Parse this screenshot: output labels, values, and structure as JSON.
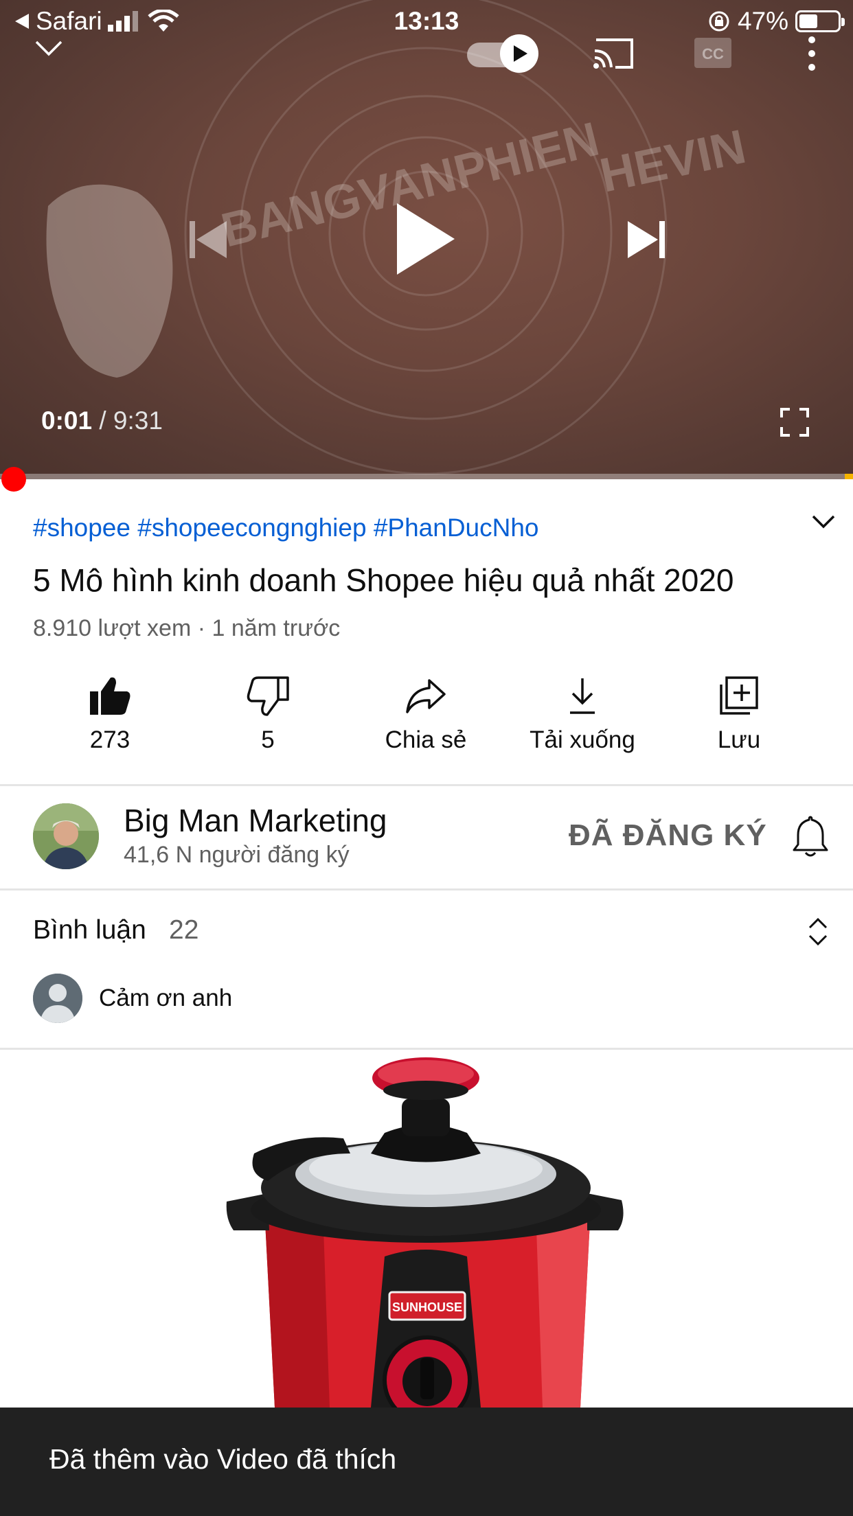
{
  "status_bar": {
    "back_app": "Safari",
    "time": "13:13",
    "battery": "47%"
  },
  "player": {
    "current_time": "0:01",
    "duration": "/ 9:31",
    "progress": 0.002,
    "autoplay_on": true,
    "icons": [
      "chevron-down-icon",
      "autoplay-toggle",
      "cast-icon",
      "cc-icon",
      "more-icon",
      "previous-icon",
      "play-icon",
      "next-icon",
      "fullscreen-icon"
    ]
  },
  "video": {
    "hashtags": "#shopee #shopeecongnghiep #PhanDucNho",
    "title": "5 Mô hình kinh doanh Shopee hiệu quả nhất 2020",
    "meta": "8.910 lượt xem · 1 năm trước"
  },
  "actions": [
    {
      "label": "273",
      "icon": "thumbs-up-filled-icon"
    },
    {
      "label": "5",
      "icon": "thumbs-down-icon"
    },
    {
      "label": "Chia sẻ",
      "icon": "share-icon"
    },
    {
      "label": "Tải xuống",
      "icon": "download-icon"
    },
    {
      "label": "Lưu",
      "icon": "save-playlist-icon"
    }
  ],
  "channel": {
    "name": "Big Man Marketing",
    "subscribers": "41,6 N người đăng ký",
    "subscribe_state": "ĐÃ ĐĂNG KÝ"
  },
  "comments": {
    "label": "Bình luận",
    "count": "22",
    "top_comment": "Cảm ơn anh"
  },
  "ad": {
    "brand_text": "SUNHOUSE"
  },
  "toast": {
    "message": "Đã thêm vào Video đã thích"
  },
  "colors": {
    "link": "#065fd4",
    "progress": "#ff0000",
    "toast_bg": "#212121"
  }
}
